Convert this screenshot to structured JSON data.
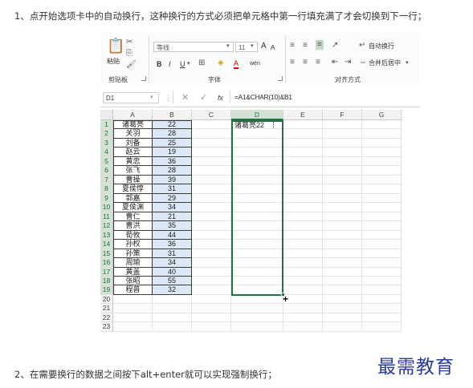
{
  "article": {
    "step1": "1、点开始选项卡中的自动换行，这种换行的方式必须把单元格中第一行填充满了才会切换到下一行；",
    "step2": "2、在需要换行的数据之间按下alt+enter就可以实现强制换行；"
  },
  "watermark": "最需教育",
  "ribbon": {
    "paste_label": "粘贴",
    "clipboard_group": "剪贴板",
    "font_name": "等线",
    "font_size": "11",
    "font_group": "字体",
    "align_group": "对齐方式",
    "wrap_text_label": "自动换行",
    "merge_center_label": "合并后居中",
    "bold": "B",
    "italic": "I",
    "underline": "U",
    "font_a_grow": "A",
    "font_a_shrink": "A",
    "wen": "wén"
  },
  "formula_bar": {
    "name_box": "D1",
    "fx": "fx",
    "formula": "=A1&CHAR(10)&B1"
  },
  "sheet": {
    "columns": [
      "A",
      "B",
      "C",
      "D",
      "E",
      "F",
      "G"
    ],
    "row_numbers": [
      "1",
      "2",
      "3",
      "4",
      "5",
      "6",
      "7",
      "8",
      "9",
      "10",
      "11",
      "12",
      "13",
      "14",
      "15",
      "16",
      "17",
      "18",
      "19",
      "20",
      "21",
      "22",
      "23"
    ],
    "names": [
      "诸葛亮",
      "关羽",
      "刘备",
      "赵云",
      "黄忠",
      "张飞",
      "曹操",
      "夏侯惇",
      "郭嘉",
      "夏侯渊",
      "曹仁",
      "曹洪",
      "荀攸",
      "孙权",
      "孙策",
      "周瑜",
      "黄盖",
      "张昭",
      "程普"
    ],
    "values": [
      "22",
      "28",
      "25",
      "19",
      "36",
      "28",
      "39",
      "31",
      "29",
      "34",
      "21",
      "35",
      "44",
      "36",
      "31",
      "34",
      "40",
      "55",
      "32"
    ],
    "d1_value": "诸葛亮22"
  },
  "colors": {
    "selection": "#217346",
    "b_fill": "#dde8f7",
    "watermark": "#2a3a9c"
  }
}
